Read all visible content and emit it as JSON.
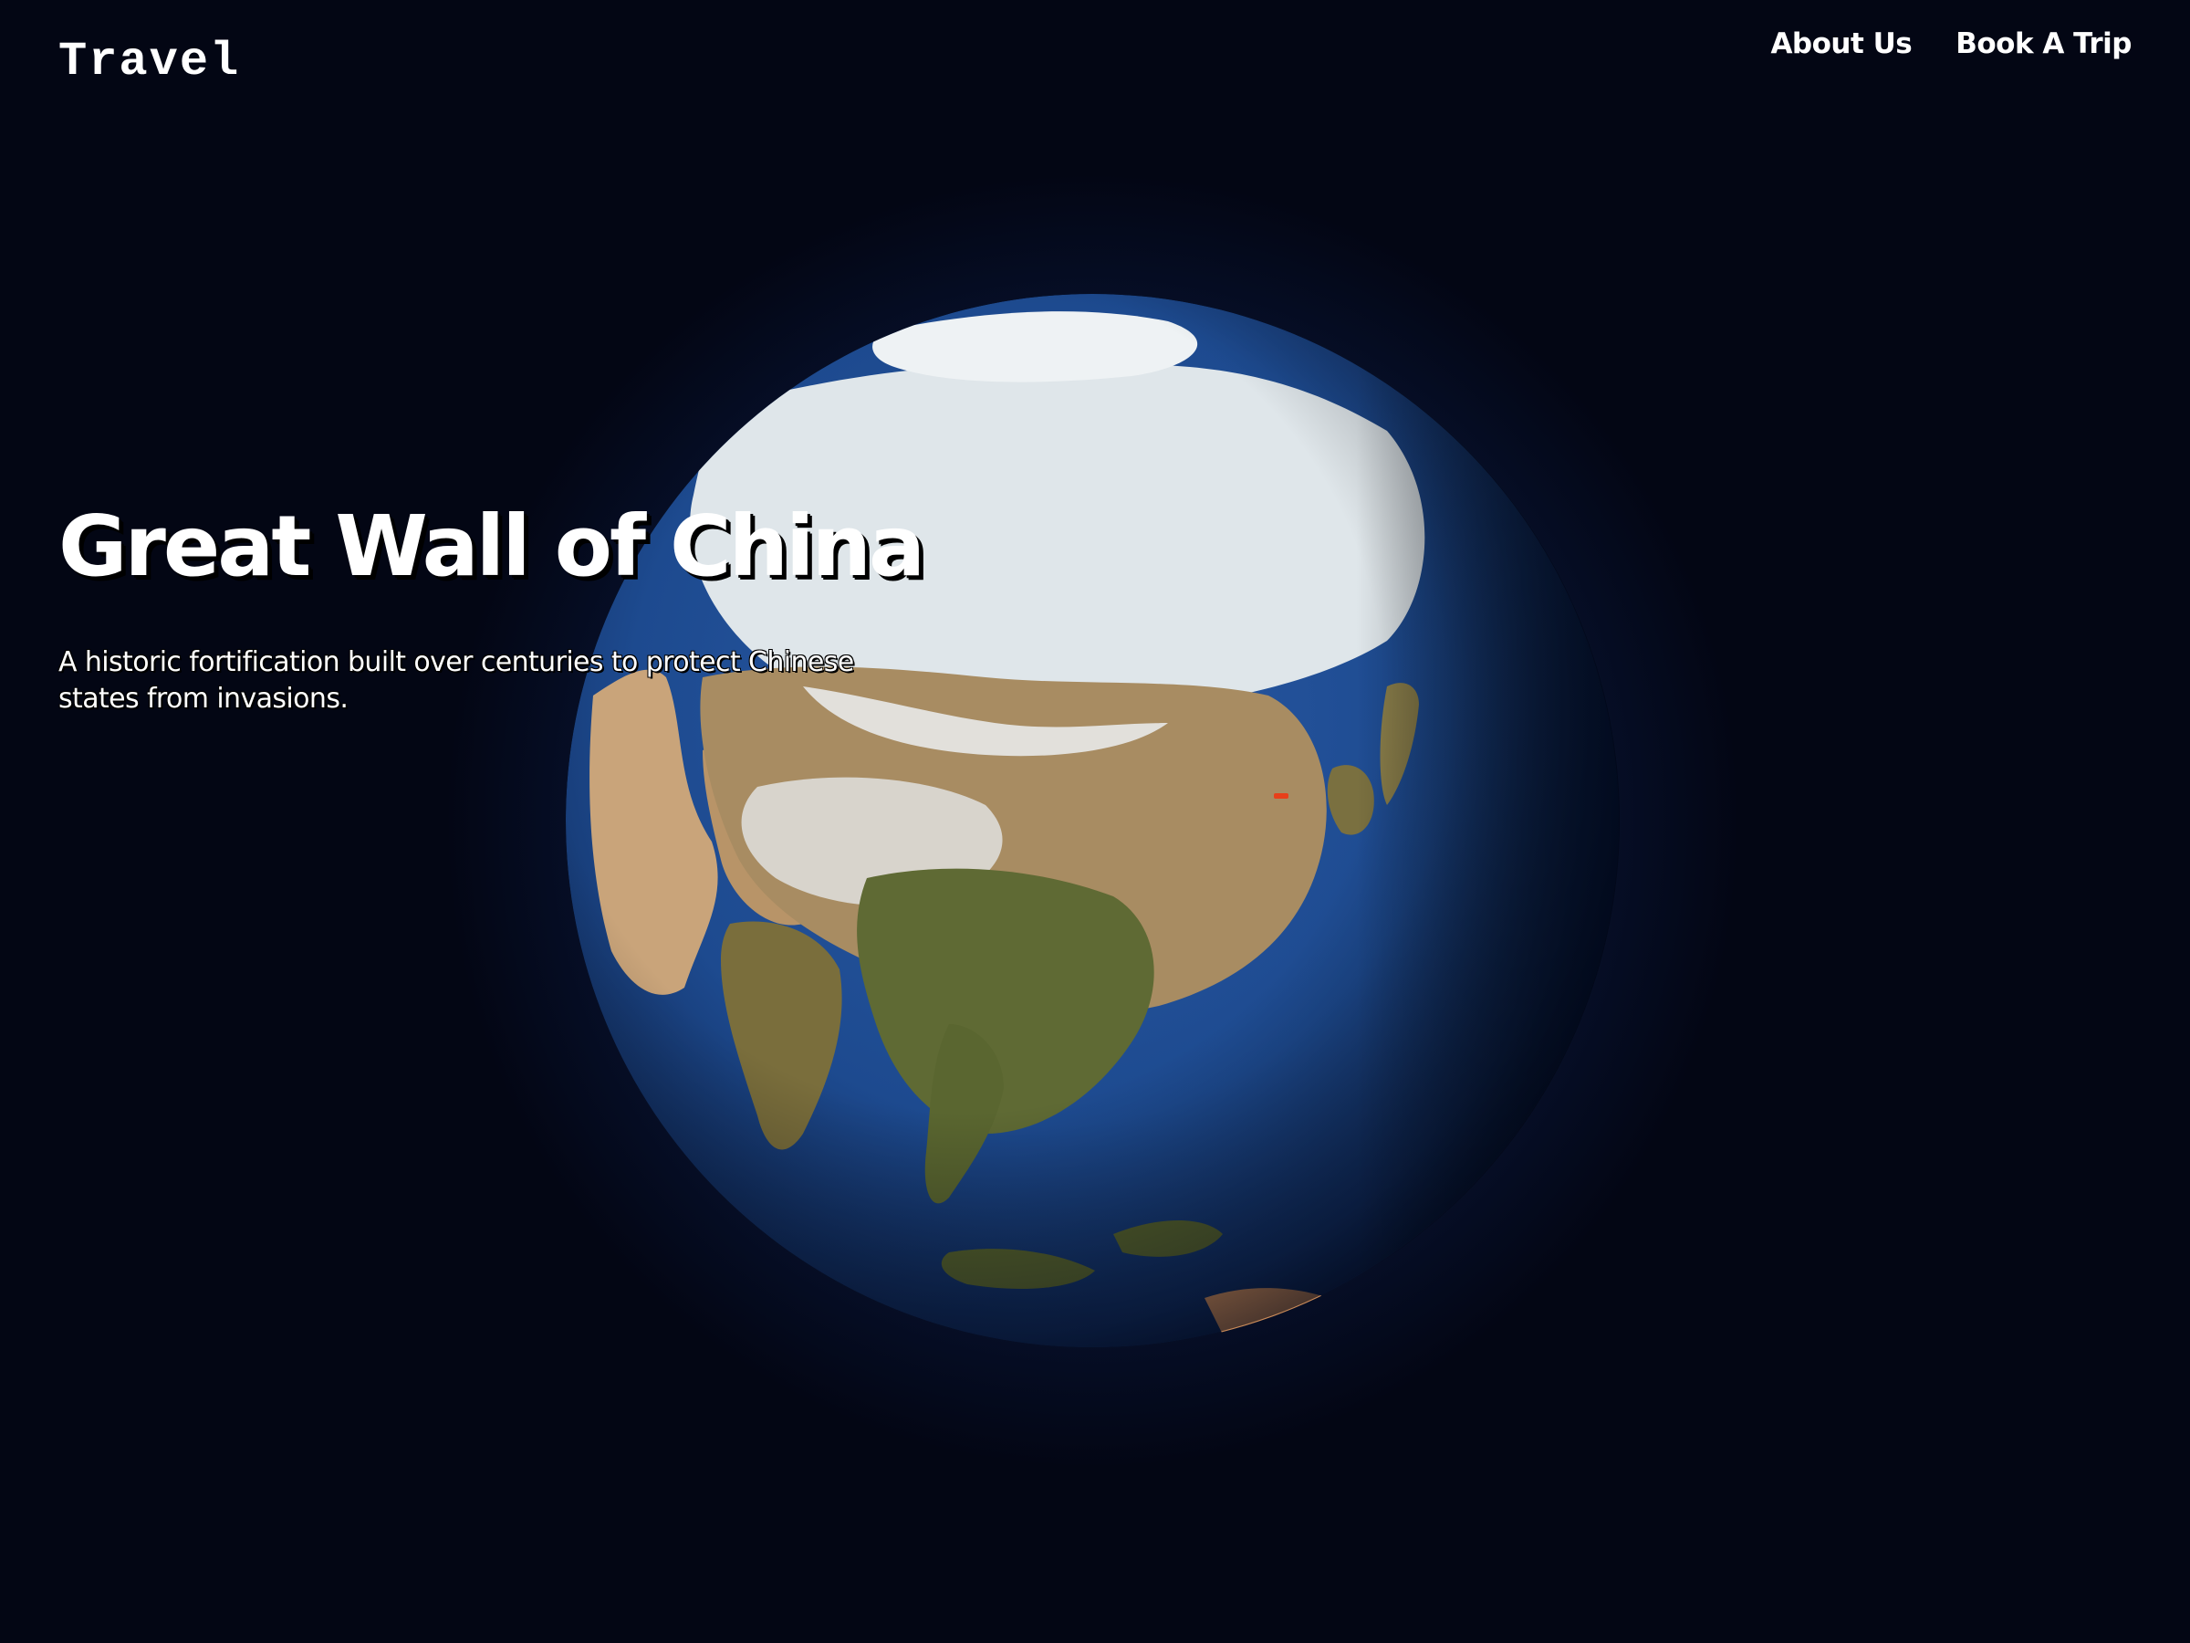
{
  "header": {
    "logo": "Travel",
    "nav": [
      {
        "label": "About Us"
      },
      {
        "label": "Book A Trip"
      }
    ]
  },
  "hero": {
    "title": "Great Wall of China",
    "description": "A historic fortification built over centuries to protect Chinese states from invasions."
  },
  "globe": {
    "ocean_color": "#1d4a8f",
    "snow_color": "#e8ecef",
    "desert_color": "#c8a878",
    "land_color": "#6b6a3c",
    "marker_color": "#e8401a"
  }
}
